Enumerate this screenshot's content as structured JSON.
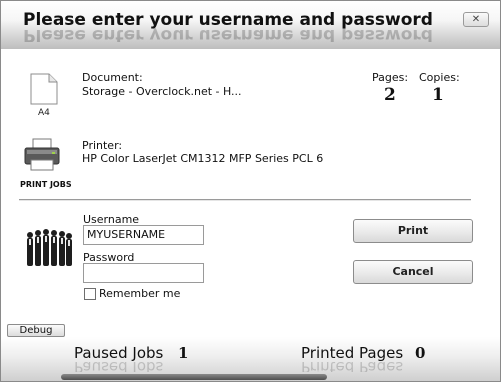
{
  "dialog": {
    "title": "Please enter your username and password",
    "close_glyph": "✕"
  },
  "document": {
    "label": "Document:",
    "value": "Storage - Overclock.net - H...",
    "paper_size": "A4",
    "icon": "document-icon"
  },
  "counts": {
    "pages_label": "Pages:",
    "pages_value": "2",
    "copies_label": "Copies:",
    "copies_value": "1"
  },
  "printer": {
    "label": "Printer:",
    "value": "HP Color LaserJet CM1312 MFP Series PCL 6",
    "caption": "PRINT JOBS",
    "icon": "printer-icon"
  },
  "login": {
    "icon": "people-icon",
    "username_label": "Username",
    "username_value": "MYUSERNAME",
    "password_label": "Password",
    "password_value": "",
    "remember_label": "Remember me",
    "remember_checked": false
  },
  "buttons": {
    "print": "Print",
    "cancel": "Cancel",
    "debug": "Debug"
  },
  "footer": {
    "paused_label": "Paused Jobs",
    "paused_value": "1",
    "printed_label": "Printed Pages",
    "printed_value": "0"
  }
}
